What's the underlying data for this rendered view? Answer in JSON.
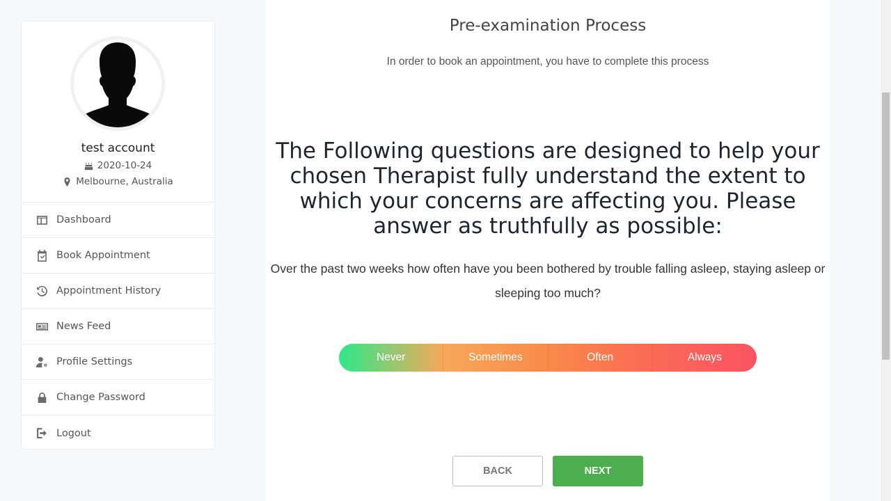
{
  "profile": {
    "name": "test account",
    "dob": "2020-10-24",
    "location": "Melbourne, Australia"
  },
  "menu": [
    {
      "label": "Dashboard",
      "icon": "dashboard-icon"
    },
    {
      "label": "Book Appointment",
      "icon": "calendar-check-icon"
    },
    {
      "label": "Appointment History",
      "icon": "history-icon"
    },
    {
      "label": "News Feed",
      "icon": "newspaper-icon"
    },
    {
      "label": "Profile Settings",
      "icon": "user-gear-icon"
    },
    {
      "label": "Change Password",
      "icon": "lock-icon"
    },
    {
      "label": "Logout",
      "icon": "logout-icon"
    }
  ],
  "main": {
    "title": "Pre-examination Process",
    "subtitle": "In order to book an appointment, you have to complete this process",
    "intro": "The Following questions are designed to help your chosen Therapist fully understand the extent to which your concerns are affecting you. Please answer as truthfully as possible:",
    "question": "Over the past two weeks how often have you been bothered by trouble falling asleep, staying asleep or sleeping too much?",
    "options": [
      "Never",
      "Sometimes",
      "Often",
      "Always"
    ],
    "back_label": "BACK",
    "next_label": "NEXT"
  },
  "colors": {
    "never": "#2ee88a",
    "sometimes": "#f7a85a",
    "often": "#f98a4a",
    "always": "#fa5462",
    "next_button": "#4cae4c"
  }
}
